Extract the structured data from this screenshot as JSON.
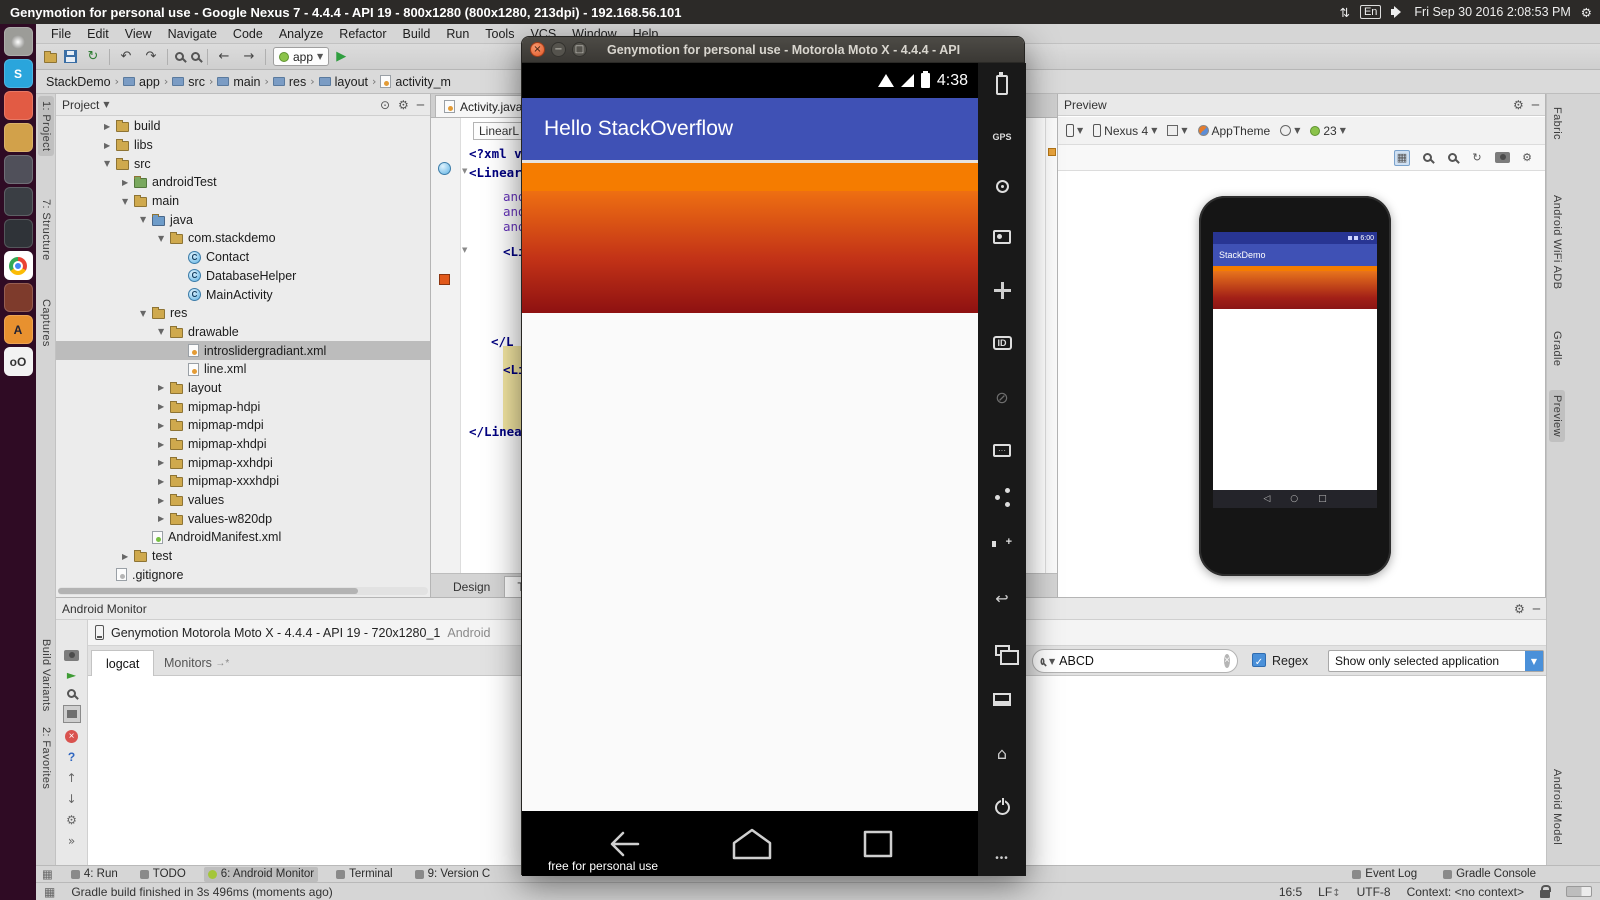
{
  "colors": {
    "app_header_blue": "#3F51B5",
    "gradient_top": "#F57C00",
    "gradient_bottom": "#8E1111",
    "preview_appbar_blue": "#3F51B5",
    "selection_gray": "#BCBCBC",
    "android_green": "#A4C639"
  },
  "system_bar": {
    "title": "Genymotion for personal use - Google Nexus 7 - 4.4.4 - API 19 - 800x1280 (800x1280, 213dpi) - 192.168.56.101",
    "keyboard": "En",
    "clock": "Fri Sep 30 2016 2:08:53 PM"
  },
  "dock": {
    "letters": {
      "s": "S",
      "studio": "A",
      "geny": "oO"
    }
  },
  "menu": {
    "items": [
      "File",
      "Edit",
      "View",
      "Navigate",
      "Code",
      "Analyze",
      "Refactor",
      "Build",
      "Run",
      "Tools",
      "VCS",
      "Window",
      "Help"
    ]
  },
  "toolbar": {
    "run_config": "app"
  },
  "breadcrumbs": [
    "StackDemo",
    "app",
    "src",
    "main",
    "res",
    "layout",
    "activity_m"
  ],
  "project_panel": {
    "title": "Project",
    "tree": [
      {
        "label": "build"
      },
      {
        "label": "libs"
      },
      {
        "label": "src"
      },
      {
        "label": "androidTest"
      },
      {
        "label": "main"
      },
      {
        "label": "java"
      },
      {
        "label": "com.stackdemo"
      },
      {
        "label": "Contact"
      },
      {
        "label": "DatabaseHelper"
      },
      {
        "label": "MainActivity"
      },
      {
        "label": "res"
      },
      {
        "label": "drawable"
      },
      {
        "label": "introslidergradiant.xml"
      },
      {
        "label": "line.xml"
      },
      {
        "label": "layout"
      },
      {
        "label": "mipmap-hdpi"
      },
      {
        "label": "mipmap-mdpi"
      },
      {
        "label": "mipmap-xhdpi"
      },
      {
        "label": "mipmap-xxhdpi"
      },
      {
        "label": "mipmap-xxxhdpi"
      },
      {
        "label": "values"
      },
      {
        "label": "values-w820dp"
      },
      {
        "label": "AndroidManifest.xml"
      },
      {
        "label": "test"
      },
      {
        "label": ".gitignore"
      }
    ]
  },
  "editor": {
    "tab": "Activity.java",
    "chip": "LinearL",
    "lines": [
      "<?xml v",
      "<Linear",
      "and",
      "and",
      "and",
      "<Li",
      "</L",
      "<Li",
      "</Linea"
    ],
    "design_tab": "Design",
    "text_tab": "Te"
  },
  "preview_panel": {
    "title": "Preview",
    "device": "Nexus 4",
    "theme": "AppTheme",
    "api_level": "23",
    "phone": {
      "time": "6:00",
      "app_bar": "StackDemo"
    }
  },
  "android_monitor": {
    "title": "Android Monitor",
    "device": "Genymotion Motorola Moto X - 4.4.4 - API 19 - 720x1280_1",
    "device_suffix": "Android",
    "tab_logcat": "logcat",
    "tab_monitors": "Monitors",
    "tabs_overflow": "→*",
    "search_value": "ABCD",
    "regex_label": "Regex",
    "filter_value": "Show only selected application"
  },
  "bottom_bar": {
    "run": "4: Run",
    "todo": "TODO",
    "monitor": "6: Android Monitor",
    "terminal": "Terminal",
    "version": "9: Version C",
    "event_log": "Event Log",
    "gradle_console": "Gradle Console"
  },
  "status_bar": {
    "message": "Gradle build finished in 3s 496ms (moments ago)",
    "caret": "16:5",
    "line_sep": "LF",
    "encoding": "UTF-8",
    "context": "Context: <no context>"
  },
  "left_stripe": {
    "project": "1: Project",
    "structure": "7: Structure",
    "captures": "Captures",
    "build_variants": "Build Variants",
    "favorites": "2: Favorites"
  },
  "right_stripe": {
    "fabric": "Fabric",
    "adb": "Android WiFi ADB",
    "gradle": "Gradle",
    "preview": "Preview",
    "model": "Android Model"
  },
  "emulator": {
    "title": "Genymotion for personal use - Motorola Moto X - 4.4.4 - API",
    "time": "4:38",
    "header": "Hello StackOverflow",
    "watermark": "free for personal use",
    "gps": "GPS",
    "id": "ID",
    "more": "•••"
  }
}
